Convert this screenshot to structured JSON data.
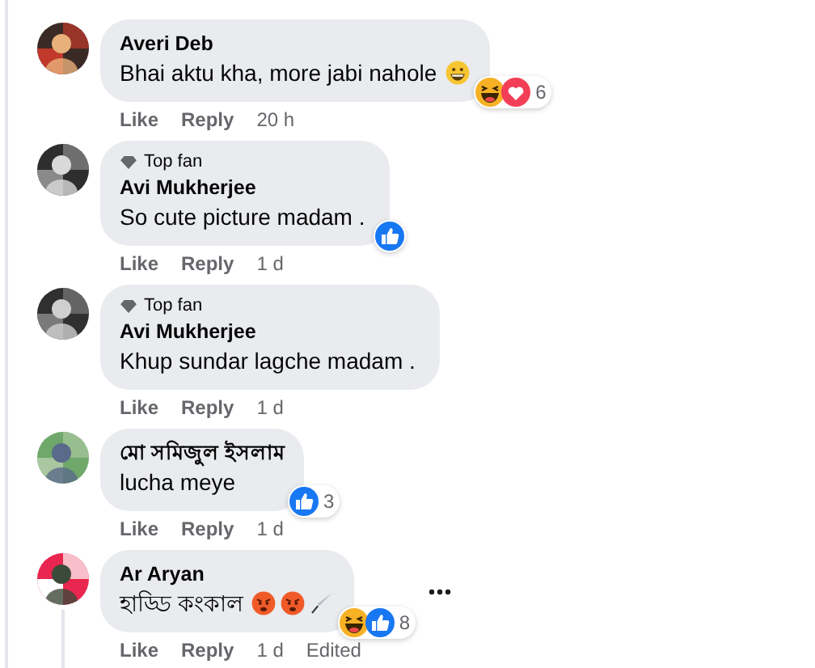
{
  "comments": [
    {
      "name": "Averi Deb",
      "text": "Bhai aktu kha, more jabi nahole",
      "emojis": [
        {
          "kind": "grin"
        }
      ],
      "reactions": {
        "icons": [
          {
            "kind": "haha"
          },
          {
            "kind": "love"
          }
        ],
        "count": "6"
      },
      "actions": [
        "Like",
        "Reply"
      ],
      "time": "20 h"
    },
    {
      "badge_label": "Top fan",
      "name": "Avi Mukherjee",
      "text": "So cute picture madam .",
      "reactions": {
        "icons": [
          {
            "kind": "like"
          }
        ]
      },
      "actions": [
        "Like",
        "Reply"
      ],
      "time": "1 d"
    },
    {
      "badge_label": "Top fan",
      "name": "Avi Mukherjee",
      "text": "Khup sundar lagche madam .",
      "actions": [
        "Like",
        "Reply"
      ],
      "time": "1 d"
    },
    {
      "name": "মো সমিজুল ইসলাম",
      "text": "lucha meye",
      "reactions": {
        "icons": [
          {
            "kind": "like"
          }
        ],
        "count": "3"
      },
      "actions": [
        "Like",
        "Reply"
      ],
      "time": "1 d"
    },
    {
      "name": "Ar Aryan",
      "text": "হাড্ডি কংকাল",
      "emojis": [
        {
          "kind": "angry"
        },
        {
          "kind": "angry"
        },
        {
          "kind": "knife"
        }
      ],
      "reactions": {
        "icons": [
          {
            "kind": "haha"
          },
          {
            "kind": "like"
          }
        ],
        "count": "8"
      },
      "actions": [
        "Like",
        "Reply"
      ],
      "time": "1 d",
      "edited": "Edited",
      "has_replies": true,
      "menu": true
    }
  ]
}
